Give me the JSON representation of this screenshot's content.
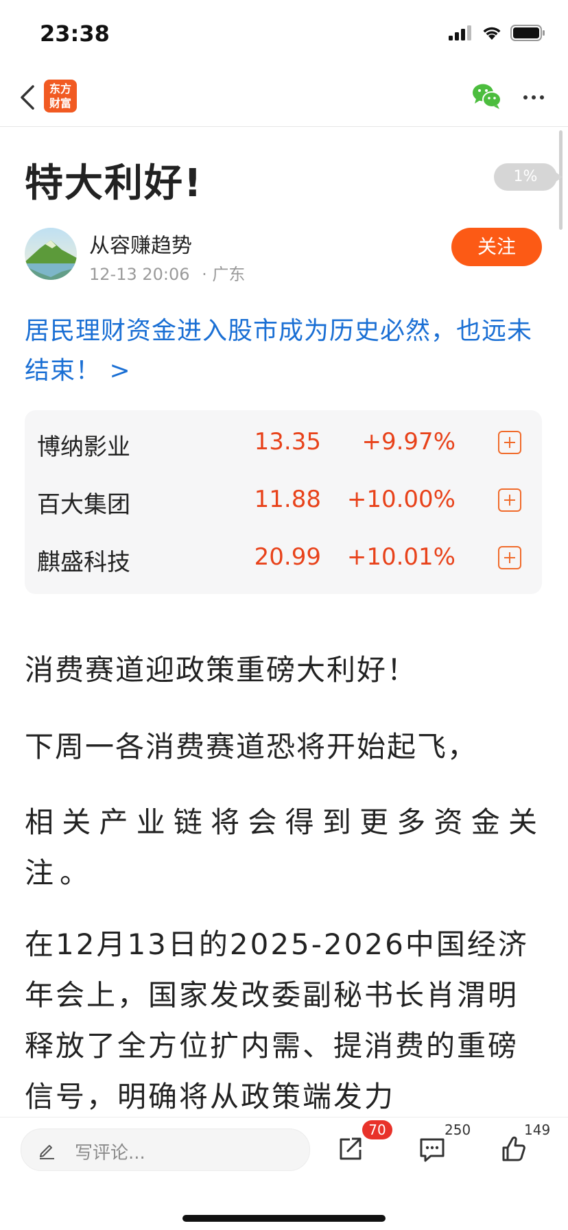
{
  "status_bar": {
    "time": "23:38"
  },
  "nav": {
    "logo_line1": "东方",
    "logo_line2": "财富",
    "logo_color": "#f15a22"
  },
  "article": {
    "title": "特大利好!",
    "read_progress": "1%",
    "author": {
      "name": "从容赚趋势",
      "datetime": "12-13 20:06",
      "location": "· 广东"
    },
    "follow_label": "关注",
    "topic_link": "居民理财资金进入股市成为历史必然，也远未结束！ >",
    "stocks": [
      {
        "name": "博纳影业",
        "price": "13.35",
        "change": "+9.97%"
      },
      {
        "name": "百大集团",
        "price": "11.88",
        "change": "+10.00%"
      },
      {
        "name": "麒盛科技",
        "price": "20.99",
        "change": "+10.01%"
      }
    ],
    "paragraphs": [
      "消费赛道迎政策重磅大利好！",
      "下周一各消费赛道恐将开始起飞，",
      "相关产业链将会得到更多资金关注。",
      "在12月13日的2025-2026中国经济年会上，国家发改委副秘书长肖渭明释放了全方位扩内需、提消费的重磅信号，明确将从政策端发力"
    ]
  },
  "bottom_bar": {
    "comment_placeholder": "写评论...",
    "share_count": "70",
    "comment_count": "250",
    "like_count": "149"
  },
  "colors": {
    "accent_orange": "#fc5a15",
    "stock_red": "#e8421a",
    "link_blue": "#1a6fd4",
    "badge_red": "#e8322a"
  },
  "icons": [
    "back-chevron-icon",
    "wechat-icon",
    "more-icon",
    "pen-icon",
    "share-icon",
    "comment-icon",
    "thumbs-up-icon",
    "add-watchlist-icon"
  ]
}
